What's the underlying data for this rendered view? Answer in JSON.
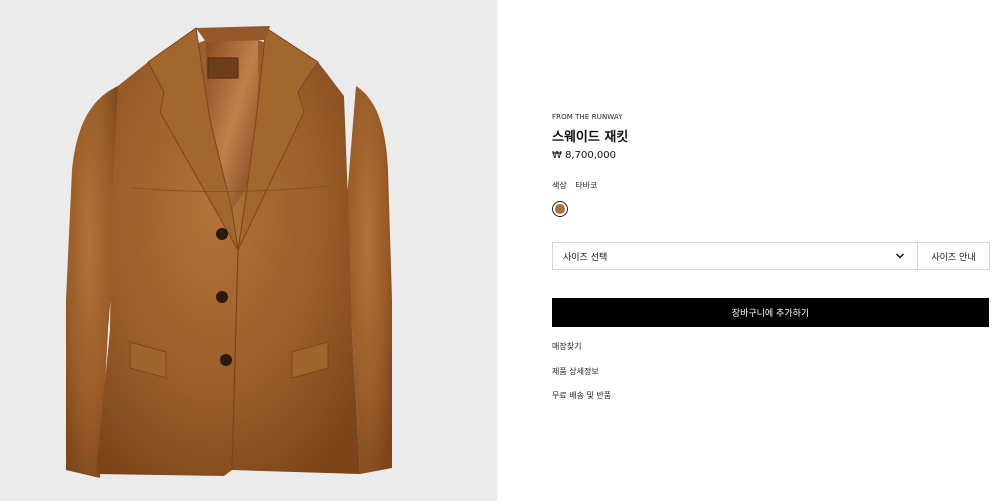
{
  "product": {
    "eyebrow": "FROM THE RUNWAY",
    "title": "스웨이드 재킷",
    "price": "₩ 8,700,000",
    "image_icon": "suede-jacket-illustration"
  },
  "color": {
    "label": "색상",
    "value": "타바코",
    "swatch_color": "#a7743f"
  },
  "size": {
    "select_label": "사이즈 선택",
    "guide_label": "사이즈 안내"
  },
  "cart": {
    "button_label": "장바구니에 추가하기"
  },
  "links": [
    {
      "label": "매장찾기"
    },
    {
      "label": "제품 상세정보"
    },
    {
      "label": "무료 배송 및 반품"
    }
  ],
  "colors": {
    "image_background": "#ebebeb",
    "button_background": "#000000",
    "suede": "#9c5f2b"
  }
}
